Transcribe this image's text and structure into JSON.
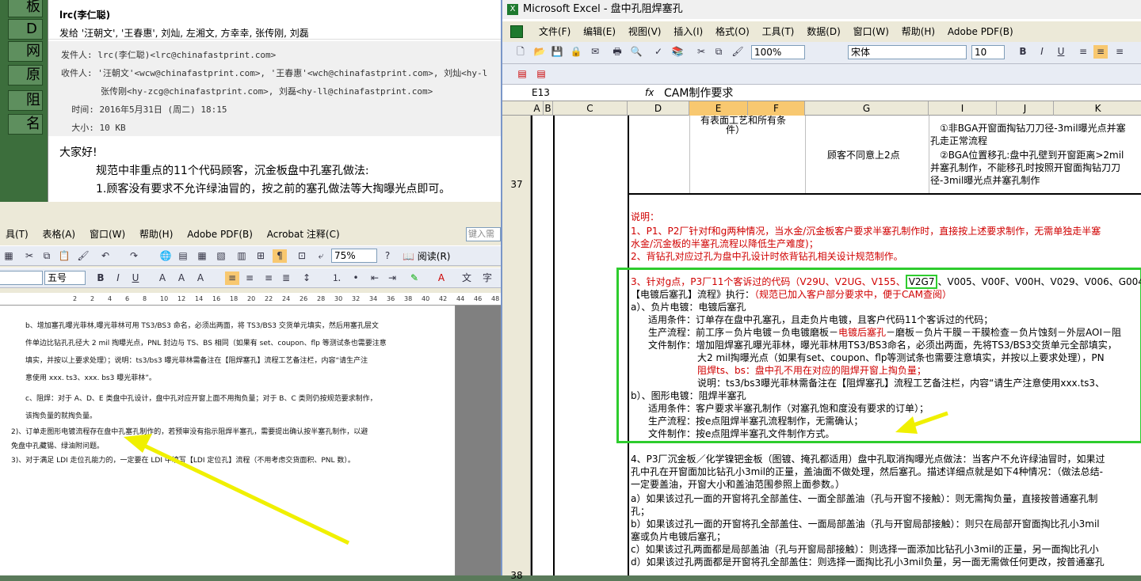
{
  "bg_panel": {
    "cells": [
      "板",
      "D",
      "网",
      "原",
      "阻",
      "名"
    ]
  },
  "email": {
    "from_name": "lrc(李仁聪)",
    "to_line": "发给 '汪朝文', '王春惠', 刘灿, 左湘文, 方幸幸, 张传刚, 刘磊",
    "sender_label": "发件人:",
    "sender": "lrc(李仁聪)<lrc@chinafastprint.com>",
    "recipients_label": "收件人:",
    "recipients_1": "'汪朝文'<wcw@chinafastprint.com>,  '王春惠'<wch@chinafastprint.com>,  刘灿<hy-l",
    "recipients_2": "张传刚<hy-zcg@chinafastprint.com>,  刘磊<hy-ll@chinafastprint.com>",
    "time_label": "时间:",
    "time": "2016年5月31日 (周二) 18:15",
    "size_label": "大小:",
    "size": "10 KB",
    "body": [
      "大家好!",
      "规范中非重点的11个代码顾客，沉金板盘中孔塞孔做法:",
      "1.顾客没有要求不允许绿油冒的，按之前的塞孔做法等大掏曝光点即可。"
    ]
  },
  "word": {
    "menu": [
      "具(T)",
      "表格(A)",
      "窗口(W)",
      "帮助(H)",
      "Adobe PDF(B)",
      "Acrobat 注释(C)"
    ],
    "help_box": "键入需",
    "zoom": "75%",
    "read_mode": "阅读(R)",
    "font_size": "五号",
    "ruler": [
      "2",
      "2",
      "4",
      "6",
      "8",
      "10",
      "12",
      "14",
      "16",
      "18",
      "20",
      "22",
      "24",
      "26",
      "28",
      "30",
      "32",
      "34",
      "36",
      "38",
      "40",
      "42",
      "44",
      "46",
      "48"
    ],
    "lines": [
      "b、增加塞孔曝光菲林,曝光菲林可用 TS3/BS3 命名，必须出两面，将 TS3/BS3 交货单元填实，然后用塞孔层文",
      "件单边比钻孔孔径大 2 mil 掏曝光点，PNL 封边与 TS、BS 相同（如果有 set、coupon、flp 等测试条也需要注意",
      "填实，并按以上要求处理）；说明：ts3/bs3 曝光菲林需备注在【阻焊塞孔】流程工艺备注栏，内容“请生产注",
      "意使用 xxx. ts3、xxx. bs3 曝光菲林”。",
      "c、阻焊：对于 A、D、E 类盘中孔设计，盘中孔对应开窗上面不用掏负量；对于 B、C 类则仍按规范要求制作，",
      "该掏负量的就掏负量。",
      "2)、订单走图形电镀流程存在盘中孔塞孔制作的，若预审没有指示阻焊半塞孔，需要提出确认按半塞孔制作，以避",
      "免盘中孔藏锡、绿油附问题。",
      "3)、对于满足 LDI 走位孔能力的，一定要在 LDI 中填写【LDI 定位孔】流程（不用考虑交货面积、PNL 数）。"
    ]
  },
  "excel": {
    "title": "Microsoft Excel - 盘中孔阻焊塞孔",
    "menu": [
      "文件(F)",
      "编辑(E)",
      "视图(V)",
      "插入(I)",
      "格式(O)",
      "工具(T)",
      "数据(D)",
      "窗口(W)",
      "帮助(H)",
      "Adobe PDF(B)"
    ],
    "zoom": "100%",
    "font": "宋体",
    "font_size": "10",
    "name_box": "E13",
    "fx": "fx",
    "formula": "CAM制作要求",
    "columns": [
      "A",
      "B",
      "C",
      "D",
      "E",
      "F",
      "G",
      "I",
      "J",
      "K"
    ],
    "row_numbers": [
      "37",
      "38"
    ],
    "cells": {
      "ef_top": "有表面工艺和所有条",
      "ef_top2": "件）",
      "g": "顾客不同意上2点",
      "i1": "①非BGA开窗面掏钻刀刀径-3mil曝光点并塞",
      "i2": "孔走正常流程",
      "i3": "②BGA位置移孔:盘中孔壁到开窗距离>2mil",
      "i4": "并塞孔制作，不能移孔时按照开窗面掏钻刀刀",
      "i5": "径-3mil曝光点并塞孔制作"
    },
    "notes": {
      "title": "说明：",
      "n1": "1、P1、P2厂针对f和g两种情况，当水金/沉金板客户要求半塞孔制作时，直接按上述要求制作，无需单独走半塞",
      "n1b": "水金/沉金板的半塞孔流程以降低生产难度)；",
      "n2": "2、背钻孔对应过孔为盘中孔设计时依背钻孔相关设计规范制作。",
      "n3a": "3、针对g点，P3厂11个客诉过的代码（V29U、V2UG、V155、",
      "n3code": "V2G7",
      "n3b": "、V005、V00F、V00H、V029、V006、G004、A",
      "n3c": "【电镀后塞孔】流程》执行：",
      "n3c_red": "（规范已加入客户部分要求中，便于CAM查阅）",
      "a_title": "a）、负片电镀：电镀后塞孔",
      "a1": "适用条件：订单存在盘中孔塞孔，且走负片电镀，且客户代码11个客诉过的代码；",
      "a2a": "生产流程：前工序－负片电镀－负电镀磨板－",
      "a2red": "电镀后塞孔",
      "a2b": "－磨板－负片干膜－干膜检查－负片蚀刻－外层AOI－阻",
      "a3": "文件制作：增加阻焊塞孔曝光菲林，曝光菲林用TS3/BS3命名，必须出两面，先将TS3/BS3交货单元全部填实，",
      "a4": "大2 mil掏曝光点（如果有set、coupon、flp等测试条也需要注意填实，并按以上要求处理），PN",
      "a5": "阻焊ts、bs：盘中孔不用在对应的阻焊开窗上掏负量；",
      "a6": "说明：ts3/bs3曝光菲林需备注在【阻焊塞孔】流程工艺备注栏，内容“请生产注意使用xxx.ts3、",
      "b_title": "b）、图形电镀：阻焊半塞孔",
      "b1": "适用条件：客户要求半塞孔制作（对塞孔饱和度没有要求的订单）；",
      "b2": "生产流程：按e点阻焊半塞孔流程制作，无需确认；",
      "b3": "文件制作：按e点阻焊半塞孔文件制作方式。",
      "n4": "4、P3厂沉金板／化学镍钯金板（图镀、掩孔都适用）盘中孔取消掏曝光点做法：当客户不允许绿油冒时，如果过",
      "n4b": "孔中孔在开窗面加比钻孔小3mil的正量，盖油面不做处理，然后塞孔。描述详细点就是如下4种情况：（做法总结-",
      "n4c": "一定要盖油，开窗大小和盖油范围参照上面参数。）",
      "d1": "a）如果该过孔一面的开窗将孔全部盖住、一面全部盖油（孔与开窗不接触）：则无需掏负量，直接按普通塞孔制",
      "d1b": "孔；",
      "d2": "b）如果该过孔一面的开窗将孔全部盖住、一面局部盖油（孔与开窗局部接触）：则只在局部开窗面掏比孔小3mil",
      "d2b": "塞或负片电镀后塞孔；",
      "d3": "c）如果该过孔两面都是局部盖油（孔与开窗局部接触）：则选择一面添加比钻孔小3mil的正量，另一面掏比孔小",
      "d4": "d）如果该过孔两面都是开窗将孔全部盖住：则选择一面掏比孔小3mil负量，另一面无需做任何更改，按普通塞孔"
    }
  },
  "colors": {
    "highlight_box": "#2ecc2e",
    "arrow": "#f0f000",
    "red_text": "#d00000"
  }
}
